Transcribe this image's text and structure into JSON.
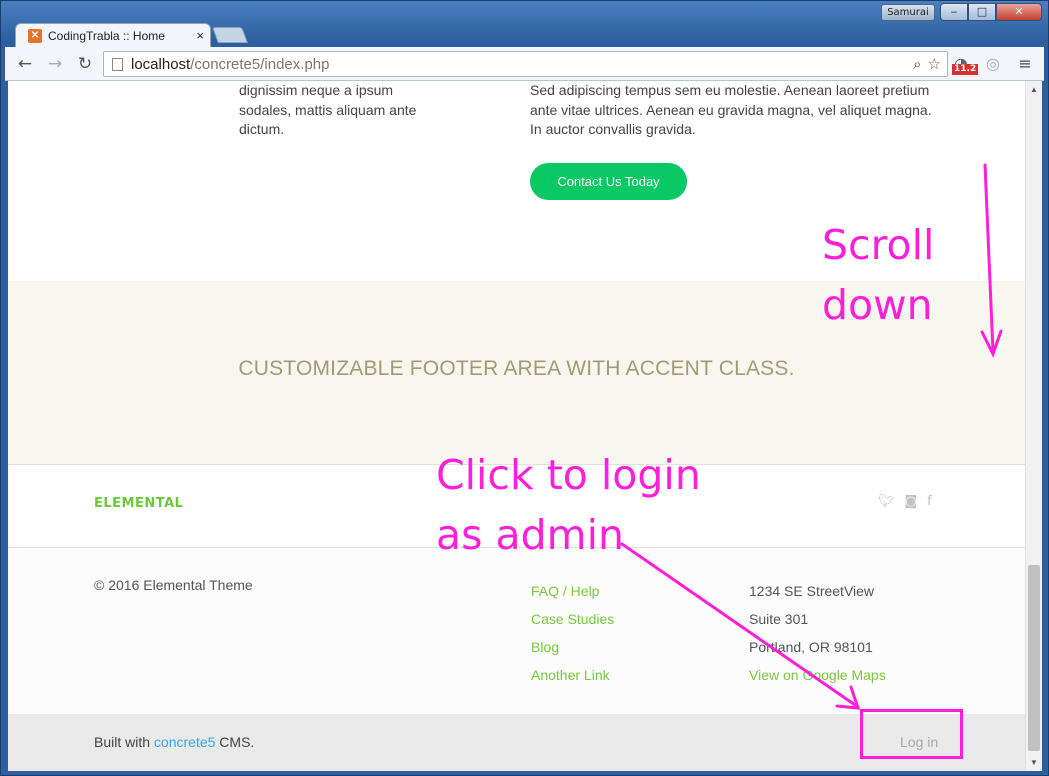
{
  "window": {
    "user_label": "Samurai",
    "minimize_glyph": "‒",
    "maximize_glyph": "□",
    "close_glyph": "✕"
  },
  "tab": {
    "title": "CodingTrabla :: Home",
    "close_glyph": "×"
  },
  "toolbar": {
    "url_host": "localhost",
    "url_path": "/concrete5/index.php",
    "badge": "11.2"
  },
  "content": {
    "left_column_text": "dignissim neque a ipsum sodales, mattis aliquam ante dictum.",
    "right_column_text": "Sed adipiscing tempus sem eu molestie. Aenean laoreet pretium ante vitae ultrices. Aenean eu gravida magna, vel aliquet magna. In auctor convallis gravida.",
    "contact_button": "Contact Us Today"
  },
  "accent_footer": {
    "text": "CUSTOMIZABLE FOOTER AREA WITH ACCENT CLASS."
  },
  "brand": {
    "logo_text": "ELEMENTAL",
    "social_icons": [
      "twitter-icon",
      "github-icon",
      "facebook-icon"
    ]
  },
  "footer": {
    "copyright": "© 2016 Elemental Theme",
    "links": [
      "FAQ / Help",
      "Case Studies",
      "Blog",
      "Another Link"
    ],
    "address": [
      "1234 SE StreetView",
      "Suite 301",
      "Portland, OR 98101"
    ],
    "map_link": "View on Google Maps"
  },
  "bottom_bar": {
    "built_prefix": "Built with ",
    "cms_link": "concrete5",
    "built_suffix": " CMS.",
    "login": "Log in"
  },
  "annotations": {
    "scroll_line1": "Scroll",
    "scroll_line2": "down",
    "login_line1": "Click to login",
    "login_line2": "as admin",
    "color": "#ff1fd8"
  },
  "colors": {
    "accent_green": "#78c83e",
    "button_green": "#0ac864",
    "link_blue": "#37a6e6"
  }
}
